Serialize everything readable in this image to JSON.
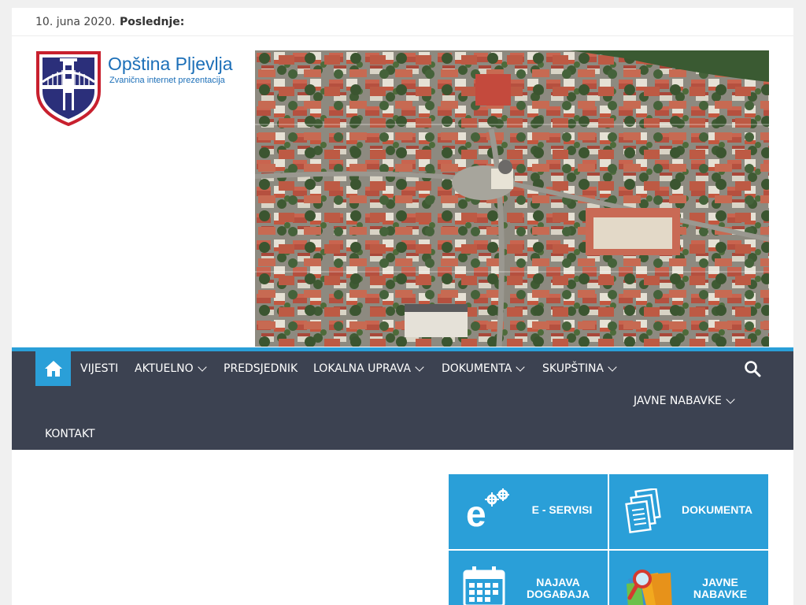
{
  "topbar": {
    "date": "10. juna 2020.",
    "latest_label": "Poslednje:"
  },
  "header": {
    "site_title": "Opština Pljevlja",
    "tagline": "Zvanična internet prezentacija"
  },
  "nav": {
    "home_icon": "home-icon",
    "items": [
      {
        "label": "VIJESTI",
        "has_dropdown": false
      },
      {
        "label": "AKTUELNO",
        "has_dropdown": true
      },
      {
        "label": "PREDSJEDNIK",
        "has_dropdown": false
      },
      {
        "label": "LOKALNA UPRAVA",
        "has_dropdown": true
      },
      {
        "label": "DOKUMENTA",
        "has_dropdown": true
      },
      {
        "label": "SKUPŠTINA",
        "has_dropdown": true
      },
      {
        "label": "JAVNE NABAVKE",
        "has_dropdown": true
      },
      {
        "label": "KONTAKT",
        "has_dropdown": false
      }
    ],
    "search_icon": "search-icon"
  },
  "tiles": [
    {
      "label": "E - SERVISI",
      "icon": "e-gears-icon"
    },
    {
      "label": "DOKUMENTA",
      "icon": "documents-icon"
    },
    {
      "label": "NAJAVA DOGAĐAJA",
      "line1": "NAJAVA",
      "line2": "DOGAĐAJA",
      "icon": "calendar-icon"
    },
    {
      "label": "JAVNE NABAVKE",
      "line1": "JAVNE",
      "line2": "NABAVKE",
      "icon": "folders-magnifier-icon"
    }
  ],
  "colors": {
    "accent": "#2a9fd8",
    "nav_bg": "#3c4251",
    "title_blue": "#1c6fb8",
    "shield_red": "#c8202e",
    "shield_navy": "#2b2f7a"
  }
}
